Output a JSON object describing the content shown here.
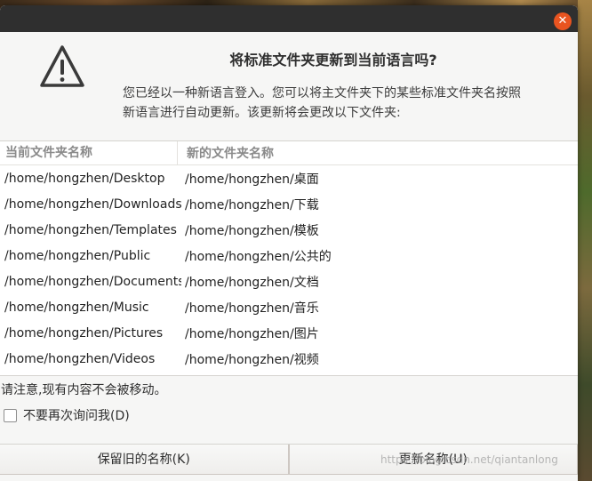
{
  "dialog": {
    "close_glyph": "✕",
    "title": "将标准文件夹更新到当前语言吗?",
    "message_line1": "您已经以一种新语言登入。您可以将主文件夹下的某些标准文件夹名按照",
    "message_line2": "新语言进行自动更新。该更新将会更改以下文件夹:",
    "table": {
      "col_current": "当前文件夹名称",
      "col_new": "新的文件夹名称",
      "rows": [
        {
          "current": "/home/hongzhen/Desktop",
          "new": "/home/hongzhen/桌面"
        },
        {
          "current": "/home/hongzhen/Downloads",
          "new": "/home/hongzhen/下载"
        },
        {
          "current": "/home/hongzhen/Templates",
          "new": "/home/hongzhen/模板"
        },
        {
          "current": "/home/hongzhen/Public",
          "new": "/home/hongzhen/公共的"
        },
        {
          "current": "/home/hongzhen/Documents",
          "new": "/home/hongzhen/文档"
        },
        {
          "current": "/home/hongzhen/Music",
          "new": "/home/hongzhen/音乐"
        },
        {
          "current": "/home/hongzhen/Pictures",
          "new": "/home/hongzhen/图片"
        },
        {
          "current": "/home/hongzhen/Videos",
          "new": "/home/hongzhen/视频"
        }
      ]
    },
    "note": "请注意,现有内容不会被移动。",
    "checkbox_label": "不要再次询问我(D)",
    "checkbox_checked": false,
    "button_keep": "保留旧的名称(K)",
    "button_update": "更新名称(U)",
    "accent_color": "#e95420"
  },
  "watermark": "https://blog.csdn.net/qiantanlong"
}
